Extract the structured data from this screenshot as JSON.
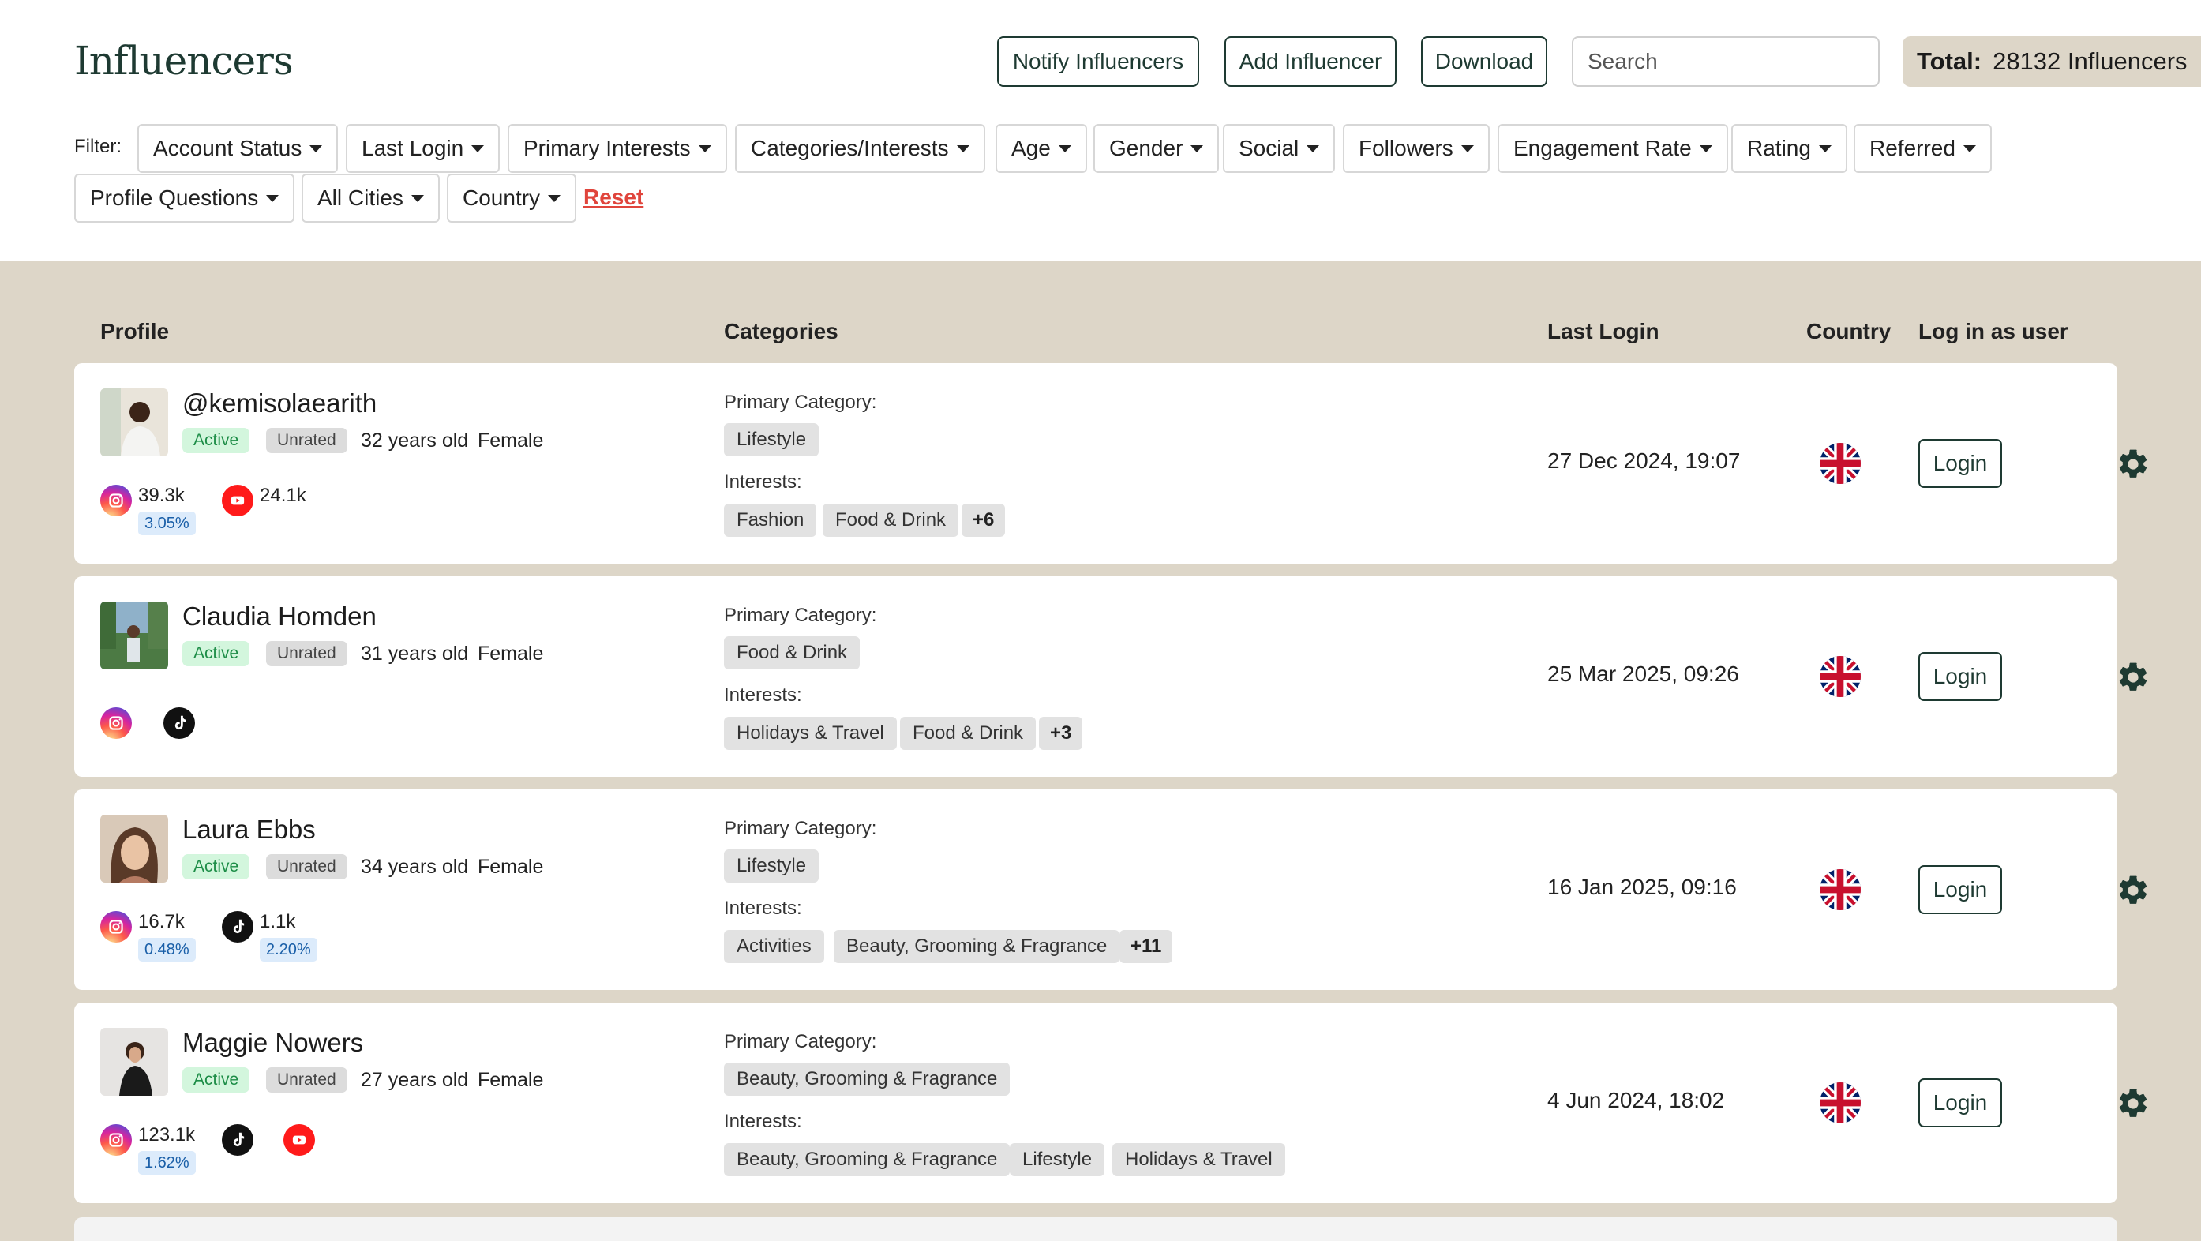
{
  "header": {
    "title": "Influencers",
    "notify_label": "Notify Influencers",
    "add_label": "Add Influencer",
    "download_label": "Download",
    "search_placeholder": "Search",
    "total_label": "Total:",
    "total_value": "28132 Influencers"
  },
  "filters": {
    "label": "Filter:",
    "items": [
      "Account Status",
      "Last Login",
      "Primary Interests",
      "Categories/Interests",
      "Age",
      "Gender",
      "Social",
      "Followers",
      "Engagement Rate",
      "Rating",
      "Referred",
      "Profile Questions",
      "All Cities",
      "Country"
    ],
    "reset_label": "Reset"
  },
  "table": {
    "columns": {
      "profile": "Profile",
      "categories": "Categories",
      "last_login": "Last Login",
      "country": "Country",
      "login_as": "Log in as user"
    }
  },
  "labels": {
    "primary_category": "Primary Category:",
    "interests": "Interests:",
    "status_active": "Active",
    "rating_unrated": "Unrated",
    "login_button": "Login"
  },
  "rows": [
    {
      "name": "@kemisolaearith",
      "age": "32 years old",
      "gender": "Female",
      "instagram_followers": "39.3k",
      "instagram_engagement": "3.05%",
      "youtube_followers": "24.1k",
      "primary_category": "Lifestyle",
      "interests": [
        "Fashion",
        "Food & Drink"
      ],
      "interests_more": "+6",
      "last_login": "27 Dec 2024, 19:07",
      "country_flag": "uk-flag-icon"
    },
    {
      "name": "Claudia Homden",
      "age": "31 years old",
      "gender": "Female",
      "primary_category": "Food & Drink",
      "interests": [
        "Holidays & Travel",
        "Food & Drink"
      ],
      "interests_more": "+3",
      "last_login": "25 Mar 2025, 09:26",
      "country_flag": "uk-flag-icon"
    },
    {
      "name": "Laura Ebbs",
      "age": "34 years old",
      "gender": "Female",
      "instagram_followers": "16.7k",
      "instagram_engagement": "0.48%",
      "tiktok_followers": "1.1k",
      "tiktok_engagement": "2.20%",
      "primary_category": "Lifestyle",
      "interests": [
        "Activities",
        "Beauty, Grooming & Fragrance"
      ],
      "interests_more": "+11",
      "last_login": "16 Jan 2025, 09:16",
      "country_flag": "uk-flag-icon"
    },
    {
      "name": "Maggie Nowers",
      "age": "27 years old",
      "gender": "Female",
      "instagram_followers": "123.1k",
      "instagram_engagement": "1.62%",
      "primary_category": "Beauty, Grooming & Fragrance",
      "interests": [
        "Beauty, Grooming & Fragrance",
        "Lifestyle",
        "Holidays & Travel"
      ],
      "last_login": "4 Jun 2024, 18:02",
      "country_flag": "uk-flag-icon"
    }
  ],
  "colors": {
    "accent": "#1e3a32",
    "page_bg": "#ddd6c8",
    "active_bg": "#d3f6dd",
    "active_text": "#1d8d47",
    "reset": "#e0453c",
    "engagement_bg": "#dcebfb"
  }
}
